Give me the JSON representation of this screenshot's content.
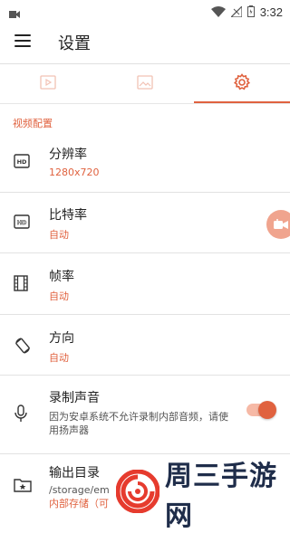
{
  "status_bar": {
    "time": "3:32"
  },
  "app_bar": {
    "title": "设置"
  },
  "tabs": [
    {
      "name": "video"
    },
    {
      "name": "image"
    },
    {
      "name": "settings",
      "selected": true
    }
  ],
  "section": {
    "title": "视频配置"
  },
  "items": [
    {
      "title": "分辨率",
      "value": "1280x720",
      "icon": "hd-icon"
    },
    {
      "title": "比特率",
      "value": "自动",
      "icon": "hd-outline-icon"
    },
    {
      "title": "帧率",
      "value": "自动",
      "icon": "film-icon"
    },
    {
      "title": "方向",
      "value": "自动",
      "icon": "rotate-icon"
    },
    {
      "title": "录制声音",
      "value": "因为安卓系统不允许录制内部音频，请使用扬声器",
      "icon": "microphone-icon",
      "toggle_on": true
    },
    {
      "title": "输出目录",
      "value_path": "/storage/em",
      "value": "内部存储（可",
      "icon": "folder-star-icon"
    }
  ],
  "watermark": {
    "text": "周三手游网"
  },
  "colors": {
    "accent": "#e0623f",
    "accent_light": "#f0a48e"
  }
}
